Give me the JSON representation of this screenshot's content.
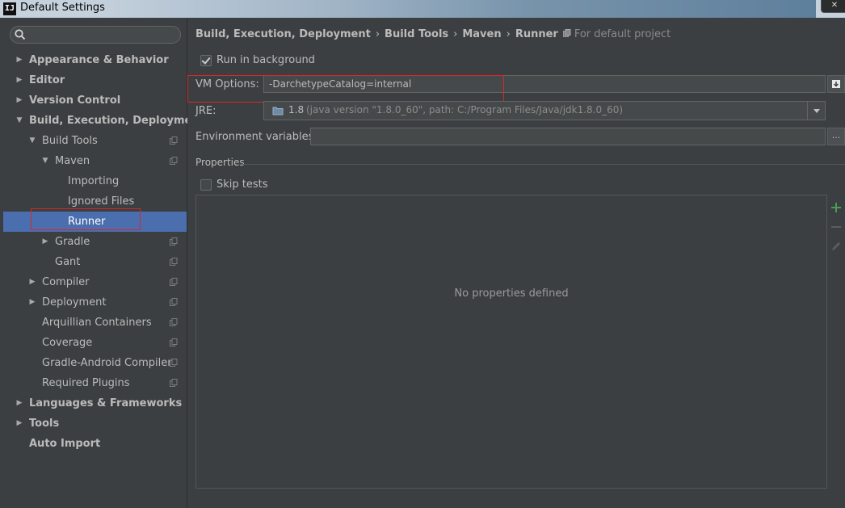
{
  "window": {
    "title": "Default Settings",
    "app_badge": "IJ",
    "close_glyph": "✕"
  },
  "sidebar": {
    "search": {
      "placeholder": "",
      "icon": "search-icon"
    },
    "items": [
      {
        "label": "Appearance & Behavior",
        "bold": true,
        "level": 0,
        "arrow": "right"
      },
      {
        "label": "Editor",
        "bold": true,
        "level": 0,
        "arrow": "right"
      },
      {
        "label": "Version Control",
        "bold": true,
        "level": 0,
        "arrow": "right"
      },
      {
        "label": "Build, Execution, Deployment",
        "bold": true,
        "level": 0,
        "arrow": "down"
      },
      {
        "label": "Build Tools",
        "bold": false,
        "level": 1,
        "arrow": "down",
        "copy": true
      },
      {
        "label": "Maven",
        "bold": false,
        "level": 2,
        "arrow": "down",
        "copy": true
      },
      {
        "label": "Importing",
        "bold": false,
        "level": 3,
        "arrow": "",
        "copy": false
      },
      {
        "label": "Ignored Files",
        "bold": false,
        "level": 3,
        "arrow": "",
        "copy": false
      },
      {
        "label": "Runner",
        "bold": false,
        "level": 3,
        "arrow": "",
        "copy": false,
        "selected": true
      },
      {
        "label": "Gradle",
        "bold": false,
        "level": 2,
        "arrow": "right",
        "copy": true
      },
      {
        "label": "Gant",
        "bold": false,
        "level": 2,
        "arrow": "",
        "copy": true
      },
      {
        "label": "Compiler",
        "bold": false,
        "level": 1,
        "arrow": "right",
        "copy": true
      },
      {
        "label": "Deployment",
        "bold": false,
        "level": 1,
        "arrow": "right",
        "copy": true
      },
      {
        "label": "Arquillian Containers",
        "bold": false,
        "level": 1,
        "arrow": "",
        "copy": true
      },
      {
        "label": "Coverage",
        "bold": false,
        "level": 1,
        "arrow": "",
        "copy": true
      },
      {
        "label": "Gradle-Android Compiler",
        "bold": false,
        "level": 1,
        "arrow": "",
        "copy": true
      },
      {
        "label": "Required Plugins",
        "bold": false,
        "level": 1,
        "arrow": "",
        "copy": true
      },
      {
        "label": "Languages & Frameworks",
        "bold": true,
        "level": 0,
        "arrow": "right"
      },
      {
        "label": "Tools",
        "bold": true,
        "level": 0,
        "arrow": "right"
      },
      {
        "label": "Auto Import",
        "bold": true,
        "level": 0,
        "arrow": ""
      }
    ]
  },
  "breadcrumb": {
    "parts": [
      "Build, Execution, Deployment",
      "Build Tools",
      "Maven",
      "Runner"
    ],
    "separator": "›",
    "note": "For default project"
  },
  "runner": {
    "run_in_background": {
      "label": "Run in background",
      "checked": true
    },
    "vm_options": {
      "label": "VM Options:",
      "value": "-DarchetypeCatalog=internal"
    },
    "jre": {
      "label": "JRE:",
      "version": "1.8",
      "detail": "(java version \"1.8.0_60\", path: C:/Program Files/Java/jdk1.8.0_60)"
    },
    "env_vars": {
      "label": "Environment variables:",
      "value": "",
      "button": "..."
    },
    "properties": {
      "title": "Properties",
      "skip_tests": {
        "label": "Skip tests",
        "checked": false
      },
      "empty_text": "No properties defined"
    }
  },
  "colors": {
    "background": "#3c3f41",
    "selection": "#4b6eaf",
    "highlight": "#d52929",
    "add": "#499c54"
  }
}
